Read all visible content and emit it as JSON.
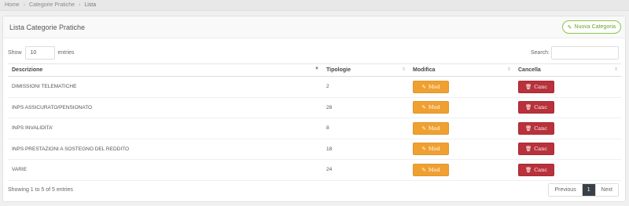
{
  "breadcrumb": {
    "home": "Home",
    "section": "Categorie Pratiche",
    "current": "Lista"
  },
  "panel": {
    "title": "Lista Categorie Pratiche",
    "new_button": "Nuova Categoria"
  },
  "controls": {
    "show_label": "Show",
    "entries_value": "10",
    "entries_label": "entries",
    "search_label": "Search:"
  },
  "table": {
    "columns": [
      "Descrizione",
      "Tipologie",
      "Modifica",
      "Cancella"
    ],
    "rows": [
      {
        "descrizione": "DIMISSIONI TELEMATICHE",
        "tipologie": "2"
      },
      {
        "descrizione": "INPS ASSICURATO/PENSIONATO",
        "tipologie": "28"
      },
      {
        "descrizione": "INPS INVALIDITA'",
        "tipologie": "8"
      },
      {
        "descrizione": "INPS PRESTAZIONI A SOSTEGNO DEL REDDITO",
        "tipologie": "18"
      },
      {
        "descrizione": "VARIE",
        "tipologie": "24"
      }
    ],
    "mod_label": "Mod",
    "canc_label": "Canc"
  },
  "footer": {
    "info": "Showing 1 to 5 of 5 entries",
    "previous": "Previous",
    "page": "1",
    "next": "Next"
  },
  "colors": {
    "mod": "#f0a030",
    "canc": "#b8313b",
    "new": "#6aa52e",
    "active_page": "#3a4048"
  },
  "icons": {
    "new": "pencil-icon",
    "mod": "edit-icon",
    "canc": "trash-icon",
    "sort": "sort-icon"
  }
}
